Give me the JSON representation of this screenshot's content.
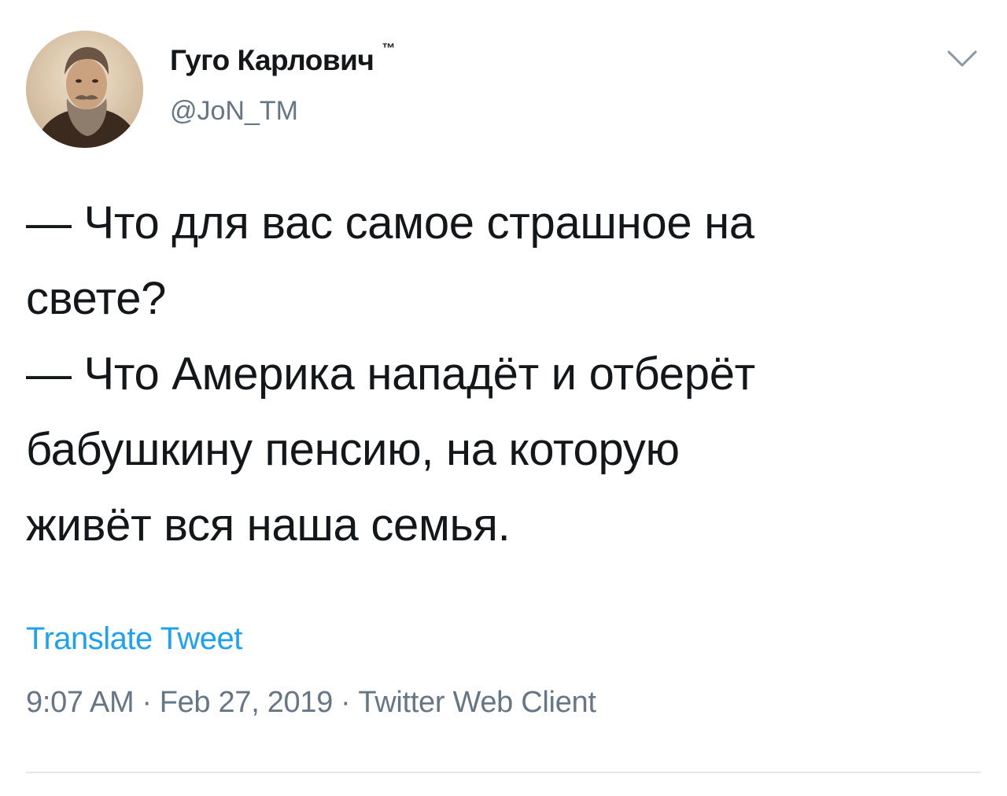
{
  "author": {
    "display_name": "Гуго Карлович",
    "badge": "™",
    "handle": "@JoN_TM"
  },
  "icons": {
    "avatar": "avatar-portrait",
    "menu": "chevron-down-icon"
  },
  "tweet": {
    "lines": [
      "— Что для вас самое страшное на",
      "свете?",
      "— Что Америка нападёт и отберёт",
      "бабушкину пенсию, на которую",
      "живёт вся наша семья."
    ],
    "translate_label": "Translate Tweet",
    "time": "9:07 AM",
    "date": "Feb 27, 2019",
    "source": "Twitter Web Client",
    "separator": "·"
  },
  "colors": {
    "text": "#14171a",
    "secondary": "#657786",
    "link": "#1da1f2",
    "divider": "#e1e8ed"
  }
}
